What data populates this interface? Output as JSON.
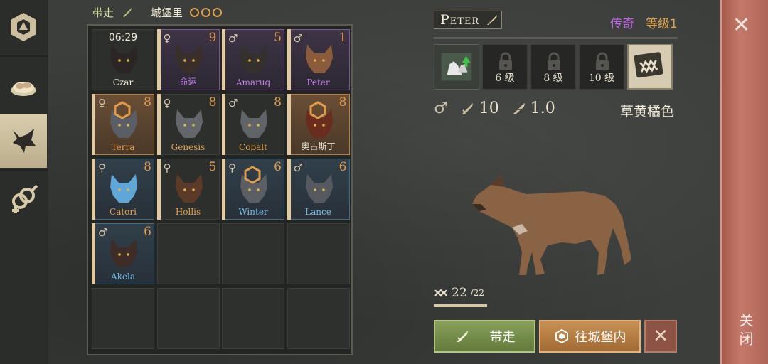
{
  "colors": {
    "accent_orange": "#e39b49",
    "legendary": "#c164ea",
    "green": "#87a05a",
    "red_panel": "#b06657"
  },
  "rail": {
    "items": [
      {
        "icon": "pack-hex-icon",
        "active": false
      },
      {
        "icon": "food-bowl-icon",
        "active": false
      },
      {
        "icon": "wolf-head-icon",
        "active": true
      },
      {
        "icon": "gender-icon",
        "active": false
      }
    ]
  },
  "topbar": {
    "take_label": "带走",
    "castle_label": "城堡里",
    "paw_count": 3
  },
  "grid": {
    "cells": [
      {
        "name": "Czar",
        "level": "",
        "sex": "",
        "time": "06:29",
        "rarity": "none",
        "fur": "#2b2624",
        "namecolor": "gray",
        "mark": false
      },
      {
        "name": "命运",
        "level": "9",
        "sex": "♀",
        "time": "",
        "rarity": "p",
        "fur": "#3a2e2a",
        "namecolor": "purple",
        "mark": false
      },
      {
        "name": "Amaruq",
        "level": "5",
        "sex": "♂",
        "time": "",
        "rarity": "p",
        "fur": "#34302c",
        "namecolor": "purple",
        "mark": false
      },
      {
        "name": "Peter",
        "level": "1",
        "sex": "♂",
        "time": "",
        "rarity": "p",
        "fur": "#8a5c3c",
        "namecolor": "purple",
        "mark": false
      },
      {
        "name": "Terra",
        "level": "8",
        "sex": "♀",
        "time": "",
        "rarity": "o",
        "fur": "#5a5e66",
        "namecolor": "orange",
        "mark": true
      },
      {
        "name": "Genesis",
        "level": "8",
        "sex": "♀",
        "time": "",
        "rarity": "none",
        "fur": "#63676b",
        "namecolor": "orange",
        "mark": false
      },
      {
        "name": "Cobalt",
        "level": "8",
        "sex": "♂",
        "time": "",
        "rarity": "none",
        "fur": "#606468",
        "namecolor": "orange",
        "mark": false
      },
      {
        "name": "奥古斯丁",
        "level": "8",
        "sex": "",
        "time": "",
        "rarity": "o",
        "fur": "#6a2c1c",
        "namecolor": "gray",
        "mark": true
      },
      {
        "name": "Catori",
        "level": "8",
        "sex": "♀",
        "time": "",
        "rarity": "b",
        "fur": "#5fa7d6",
        "namecolor": "orange",
        "mark": false
      },
      {
        "name": "Hollis",
        "level": "5",
        "sex": "♀",
        "time": "",
        "rarity": "none",
        "fur": "#5c3a28",
        "namecolor": "orange",
        "mark": false
      },
      {
        "name": "Winter",
        "level": "6",
        "sex": "♀",
        "time": "",
        "rarity": "b",
        "fur": "#5b5f64",
        "namecolor": "blue",
        "mark": true
      },
      {
        "name": "Lance",
        "level": "6",
        "sex": "♂",
        "time": "",
        "rarity": "b",
        "fur": "#56595d",
        "namecolor": "blue",
        "mark": false
      },
      {
        "name": "Akela",
        "level": "6",
        "sex": "♂",
        "time": "",
        "rarity": "b",
        "fur": "#3e2c26",
        "namecolor": "blue",
        "mark": false
      }
    ],
    "total_slots": 20
  },
  "detail": {
    "name": "Peter",
    "rarity": "传奇",
    "level": "等级1",
    "skills": [
      {
        "label": "",
        "locked": false,
        "icon": "wolf-upgrade-icon"
      },
      {
        "label": "6 级",
        "locked": true,
        "icon": "lock-icon"
      },
      {
        "label": "8 级",
        "locked": true,
        "icon": "lock-icon"
      },
      {
        "label": "10 级",
        "locked": true,
        "icon": "lock-icon"
      },
      {
        "label": "",
        "locked": false,
        "icon": "bite-card-icon"
      }
    ],
    "sex_icon": "♂",
    "attack": "10",
    "speed": "1.0",
    "color_name": "草黄橘色",
    "food_current": "22",
    "food_max": "/22",
    "food_fill": 1.0
  },
  "buttons": {
    "take": "带走",
    "castle": "往城堡内",
    "cancel": "✕"
  },
  "close": {
    "x": "✕",
    "label": "关闭"
  }
}
